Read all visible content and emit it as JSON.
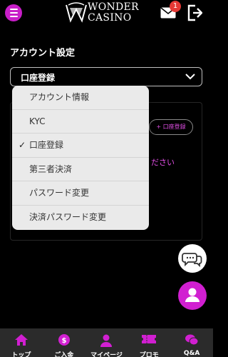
{
  "header": {
    "logo_line1": "WONDER",
    "logo_line2": "CASINO",
    "mail_badge": "1"
  },
  "page": {
    "title": "アカウント設定",
    "select_value": "口座登録"
  },
  "background": {
    "register_button_label": "+ 口座登録",
    "partial_text": "ださい"
  },
  "dropdown": {
    "selected_index": 2,
    "options": [
      {
        "label": "アカウント情報"
      },
      {
        "label": "KYC"
      },
      {
        "label": "口座登録",
        "check": "✓"
      },
      {
        "label": "第三者決済"
      },
      {
        "label": "パスワード変更"
      },
      {
        "label": "決済パスワード変更"
      }
    ]
  },
  "bottom_nav": {
    "items": [
      {
        "label": "トップ",
        "icon": "home-icon"
      },
      {
        "label": "ご入金",
        "icon": "deposit-icon"
      },
      {
        "label": "マイページ",
        "icon": "user-icon"
      },
      {
        "label": "プロモ",
        "icon": "ticket-icon"
      },
      {
        "label": "Q&A",
        "icon": "chat-icon"
      }
    ]
  },
  "colors": {
    "accent": "#c81ec8",
    "accent_text": "#e24fe6",
    "badge": "#e53935",
    "nav_bg": "#2b2b2b"
  }
}
